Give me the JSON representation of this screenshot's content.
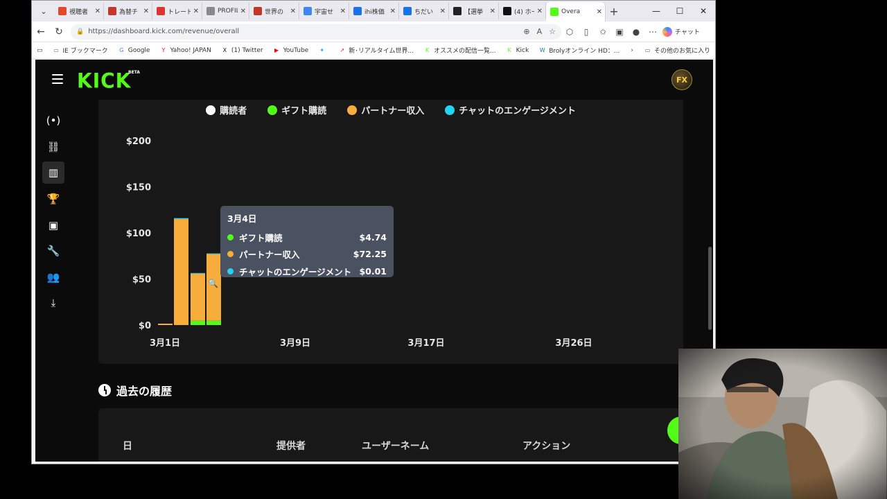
{
  "browser": {
    "tabs": [
      {
        "label": "視聴者",
        "icon_color": "#e04a2a"
      },
      {
        "label": "為替チ",
        "icon_color": "#c0392b"
      },
      {
        "label": "トレード",
        "icon_color": "#d33"
      },
      {
        "label": "PROFIL",
        "icon_color": "#888"
      },
      {
        "label": "世界の",
        "icon_color": "#c0392b"
      },
      {
        "label": "宇宙せ",
        "icon_color": "#4285f4"
      },
      {
        "label": "ihi株価",
        "icon_color": "#1a73e8"
      },
      {
        "label": "ちだい",
        "icon_color": "#1a73e8"
      },
      {
        "label": "【選挙",
        "icon_color": "#222"
      },
      {
        "label": "(4) ホー",
        "icon_color": "#111"
      },
      {
        "label": "Overa",
        "icon_color": "#53fc18",
        "active": true
      }
    ],
    "url": "https://dashboard.kick.com/revenue/overall",
    "copilot_label": "チャット",
    "bookmarks": [
      {
        "label": "IE ブックマーク",
        "icon": "folder-icon"
      },
      {
        "label": "Google",
        "icon": "google-icon"
      },
      {
        "label": "Yahoo! JAPAN",
        "icon": "yahoo-icon"
      },
      {
        "label": "(1) Twitter",
        "icon": "x-icon"
      },
      {
        "label": "YouTube",
        "icon": "youtube-icon"
      },
      {
        "label": "",
        "icon": "twitter-bird-icon"
      },
      {
        "label": "新･リアルタイム世界...",
        "icon": "chart-icon"
      },
      {
        "label": "オススメの配信一覧...",
        "icon": "kick-icon"
      },
      {
        "label": "Kick",
        "icon": "kick-icon"
      },
      {
        "label": "Brolyオンライン HD：...",
        "icon": "wordpress-icon"
      }
    ],
    "other_bookmarks": "その他のお気に入り"
  },
  "kick": {
    "logo": "KICK",
    "beta": "BETA",
    "avatar_text": "FX"
  },
  "legend": [
    {
      "label": "購読者",
      "color": "#ffffff"
    },
    {
      "label": "ギフト購読",
      "color": "#53fc18"
    },
    {
      "label": "パートナー収入",
      "color": "#f6ad3c"
    },
    {
      "label": "チャットのエンゲージメント",
      "color": "#23d3f2"
    }
  ],
  "chart_data": {
    "type": "bar",
    "stacked": true,
    "y_ticks": [
      "$200",
      "$150",
      "$100",
      "$50",
      "$0"
    ],
    "ylim": [
      0,
      200
    ],
    "x_ticks": [
      "3月1日",
      "3月9日",
      "3月17日",
      "3月26日"
    ],
    "categories": [
      "3月1日",
      "3月2日",
      "3月3日",
      "3月4日"
    ],
    "series": [
      {
        "name": "ギフト購読",
        "color": "#53fc18",
        "values": [
          0,
          0,
          4.74,
          4.74
        ]
      },
      {
        "name": "パートナー収入",
        "color": "#f6ad3c",
        "values": [
          1,
          115,
          51,
          72.25
        ]
      },
      {
        "name": "チャットのエンゲージメント",
        "color": "#23d3f2",
        "values": [
          0,
          1,
          0.01,
          0.01
        ]
      }
    ]
  },
  "tooltip": {
    "title": "3月4日",
    "rows": [
      {
        "label": "ギフト購読",
        "value": "$4.74",
        "color": "#53fc18"
      },
      {
        "label": "パートナー収入",
        "value": "$72.25",
        "color": "#f6ad3c"
      },
      {
        "label": "チャットのエンゲージメント",
        "value": "$0.01",
        "color": "#23d3f2"
      }
    ]
  },
  "history": {
    "title": "過去の履歴",
    "columns": [
      "日",
      "提供者",
      "ユーザーネーム",
      "アクション"
    ]
  }
}
